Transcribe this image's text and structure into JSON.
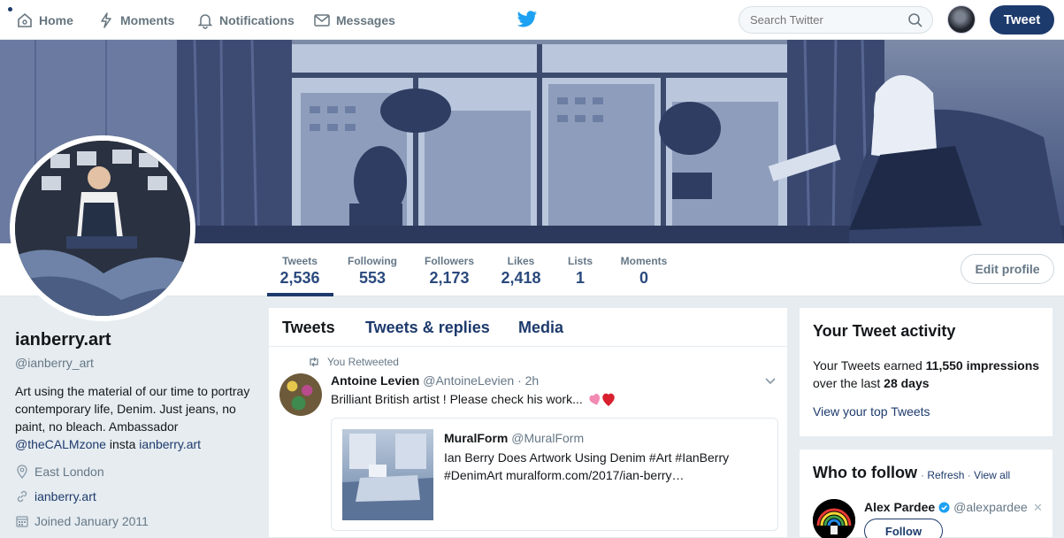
{
  "nav": {
    "home": "Home",
    "moments": "Moments",
    "notifications": "Notifications",
    "messages": "Messages",
    "search_placeholder": "Search Twitter",
    "tweet_button": "Tweet"
  },
  "profile": {
    "name": "ianberry.art",
    "handle": "@ianberry_art",
    "bio_text": "Art using the material of our time to portray contemporary life, Denim. Just jeans, no paint, no bleach. Ambassador",
    "bio_mention": "@theCALMzone",
    "bio_middle": " insta ",
    "bio_link": "ianberry.art",
    "location": "East London",
    "website": "ianberry.art",
    "joined": "Joined January 2011",
    "edit_button": "Edit profile"
  },
  "stats": [
    {
      "label": "Tweets",
      "value": "2,536"
    },
    {
      "label": "Following",
      "value": "553"
    },
    {
      "label": "Followers",
      "value": "2,173"
    },
    {
      "label": "Likes",
      "value": "2,418"
    },
    {
      "label": "Lists",
      "value": "1"
    },
    {
      "label": "Moments",
      "value": "0"
    }
  ],
  "timeline": {
    "tabs": [
      "Tweets",
      "Tweets & replies",
      "Media"
    ],
    "retweet_label": "You Retweeted",
    "tweet": {
      "author_name": "Antoine Levien",
      "author_handle": "@AntoineLevien",
      "time": "· 2h",
      "text": "Brilliant British artist ! Please check his work..."
    },
    "quote": {
      "author_name": "MuralForm",
      "author_handle": "@MuralForm",
      "text": "Ian Berry Does Artwork Using Denim #Art #IanBerry #DenimArt muralform.com/2017/ian-berry…"
    }
  },
  "activity": {
    "title": "Your Tweet activity",
    "text_pre": "Your Tweets earned ",
    "impressions": "11,550 impressions",
    "text_mid": " over the last ",
    "days": "28 days",
    "link": "View your top Tweets"
  },
  "who_to_follow": {
    "title": "Who to follow",
    "sep1": " · ",
    "refresh": "Refresh",
    "sep2": " · ",
    "view_all": "View all",
    "suggestion": {
      "name": "Alex Pardee",
      "handle": "@alexpardee",
      "follow_button": "Follow",
      "close": "✕"
    }
  },
  "colors": {
    "accent": "#1d3a6c",
    "muted": "#657786",
    "background": "#e6ecf0",
    "bird": "#1da1f2"
  }
}
